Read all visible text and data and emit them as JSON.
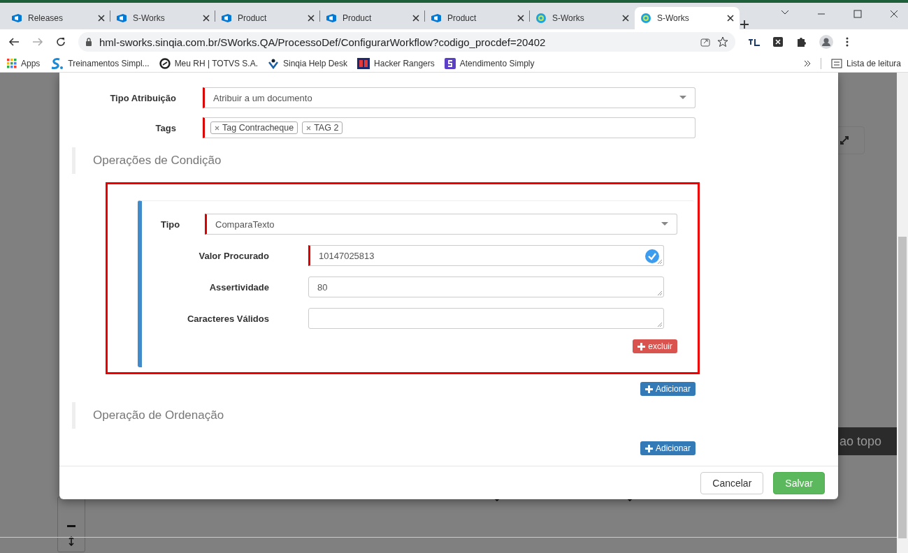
{
  "browser": {
    "tabs": [
      {
        "title": "Releases",
        "kind": "board",
        "selected": false
      },
      {
        "title": "S-Works",
        "kind": "board",
        "selected": false
      },
      {
        "title": "Product",
        "kind": "board",
        "selected": false
      },
      {
        "title": "Product",
        "kind": "board",
        "selected": false
      },
      {
        "title": "Product",
        "kind": "board",
        "selected": false
      },
      {
        "title": "S-Works",
        "kind": "ring",
        "selected": false
      },
      {
        "title": "S-Works",
        "kind": "ring",
        "selected": true
      }
    ],
    "url": "hml-sworks.sinqia.com.br/SWorks.QA/ProcessoDef/ConfigurarWorkflow?codigo_procdef=20402",
    "bookmarks": [
      {
        "label": "Apps",
        "kind": "grid"
      },
      {
        "label": "Treinamentos Simpl...",
        "kind": "s-logo"
      },
      {
        "label": "Meu RH | TOTVS S.A.",
        "kind": "circle"
      },
      {
        "label": "Sinqia Help Desk",
        "kind": "person"
      },
      {
        "label": "Hacker Rangers",
        "kind": "square"
      },
      {
        "label": "Atendimento Simply",
        "kind": "square-s"
      }
    ],
    "reading_list": "Lista de leitura"
  },
  "background": {
    "back_to_top": "ao topo"
  },
  "dialog": {
    "fields": [
      {
        "label": "Tipo Atribuição",
        "kind": "select",
        "value": "Atribuir a um documento",
        "required": true
      },
      {
        "label": "Tags",
        "kind": "tags",
        "tags": [
          "Tag Contracheque",
          "TAG 2"
        ],
        "required": true
      }
    ],
    "sections": [
      {
        "title": "Operações de Condição",
        "conditions": [
          {
            "highlighted": true,
            "delete_button": "excluir",
            "fields": [
              {
                "label": "Tipo",
                "kind": "select",
                "value": "ComparaTexto",
                "required": true
              },
              {
                "label": "Valor Procurado",
                "kind": "input",
                "value": "10147025813",
                "required": true,
                "validated": true
              },
              {
                "label": "Assertividade",
                "kind": "input",
                "value": "80",
                "required": false,
                "validated": false
              },
              {
                "label": "Caracteres Válidos",
                "kind": "textarea",
                "required": false,
                "validated": false
              }
            ]
          }
        ],
        "add_button": "Adicionar"
      },
      {
        "title": "Operação de Ordenação",
        "add_button": "Adicionar"
      }
    ],
    "cancel_button": "Cancelar",
    "save_button": "Salvar"
  }
}
